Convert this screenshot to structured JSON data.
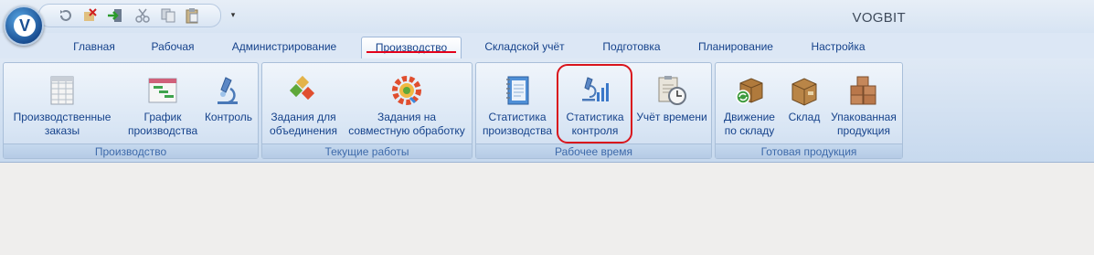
{
  "app": {
    "title": "VOGBIT",
    "orb_letter": "V"
  },
  "quick_access": {
    "buttons": [
      "refresh-icon",
      "delete-icon",
      "exit-icon",
      "cut-icon",
      "copy-icon",
      "paste-icon"
    ],
    "dropdown_glyph": "▾"
  },
  "tabs": [
    {
      "label": "Главная"
    },
    {
      "label": "Рабочая"
    },
    {
      "label": "Администрирование"
    },
    {
      "label": "Производство"
    },
    {
      "label": "Складской учёт"
    },
    {
      "label": "Подготовка"
    },
    {
      "label": "Планирование"
    },
    {
      "label": "Настройка"
    }
  ],
  "active_tab": "Производство",
  "groups": [
    {
      "label": "Производство",
      "buttons": [
        {
          "line1": "Производственные",
          "line2": "заказы"
        },
        {
          "line1": "График",
          "line2": "производства"
        },
        {
          "line1": "Контроль",
          "line2": ""
        }
      ]
    },
    {
      "label": "Текущие работы",
      "buttons": [
        {
          "line1": "Задания для",
          "line2": "объединения"
        },
        {
          "line1": "Задания на",
          "line2": "совместную обработку"
        }
      ]
    },
    {
      "label": "Рабочее время",
      "buttons": [
        {
          "line1": "Статистика",
          "line2": "производства"
        },
        {
          "line1": "Статистика",
          "line2": "контроля"
        },
        {
          "line1": "Учёт времени",
          "line2": ""
        }
      ]
    },
    {
      "label": "Готовая продукция",
      "buttons": [
        {
          "line1": "Движение",
          "line2": "по складу"
        },
        {
          "line1": "Склад",
          "line2": ""
        },
        {
          "line1": "Упакованная",
          "line2": "продукция"
        }
      ]
    }
  ],
  "colors": {
    "accent_red": "#d9141c",
    "text_blue": "#15428b"
  }
}
